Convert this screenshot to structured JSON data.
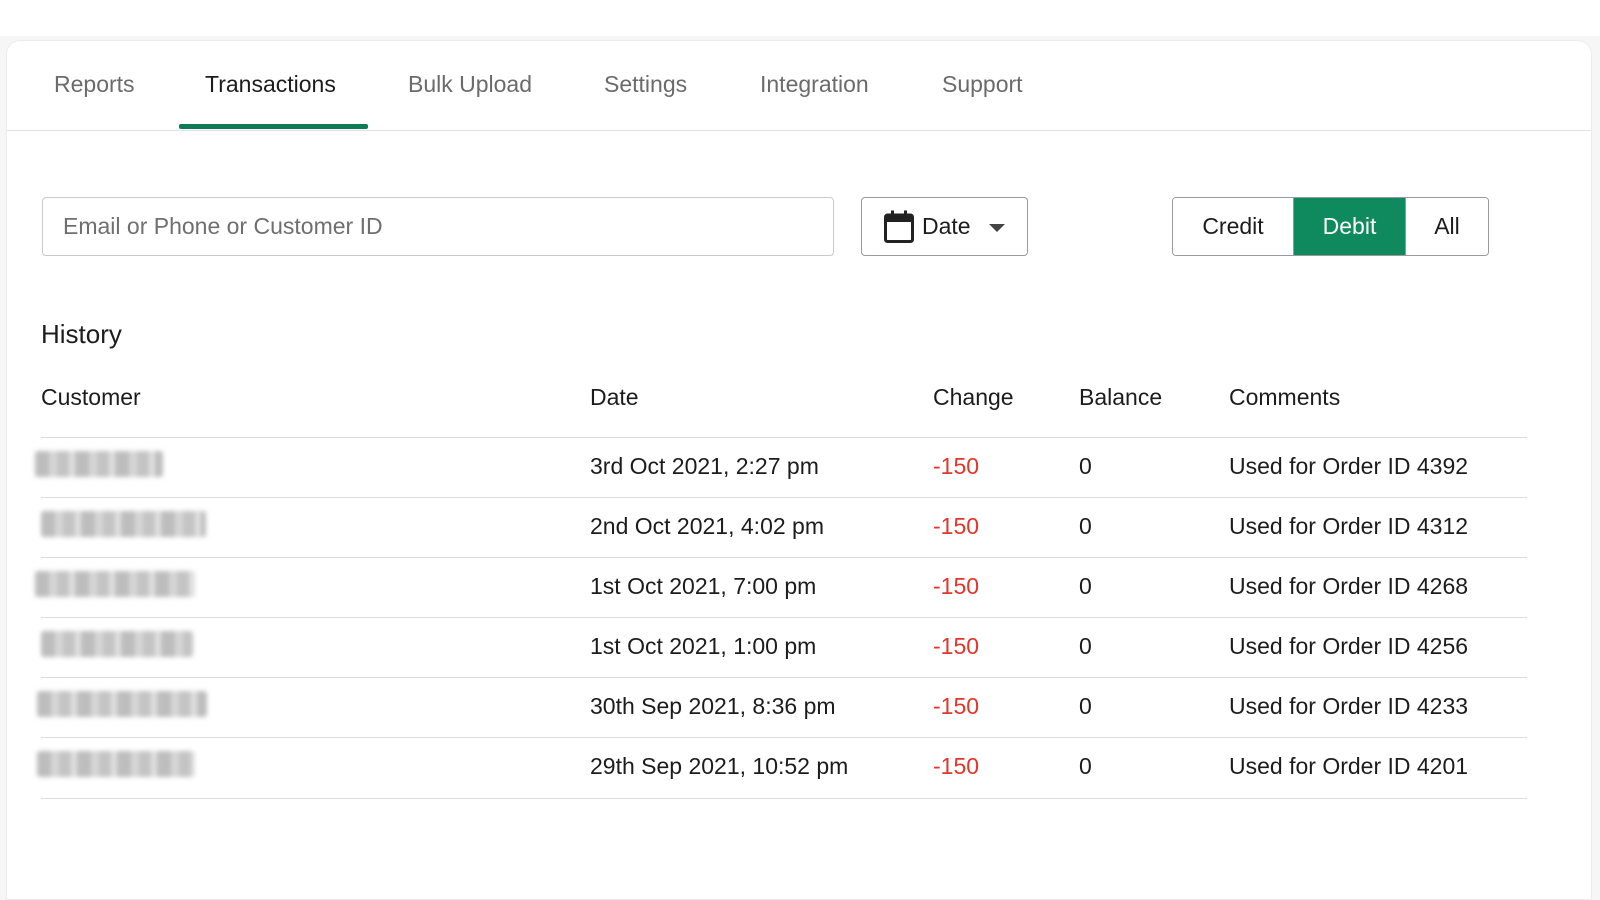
{
  "tabs": [
    {
      "label": "Reports"
    },
    {
      "label": "Transactions"
    },
    {
      "label": "Bulk Upload"
    },
    {
      "label": "Settings"
    },
    {
      "label": "Integration"
    },
    {
      "label": "Support"
    }
  ],
  "active_tab": "Transactions",
  "search": {
    "placeholder": "Email or Phone or Customer ID",
    "value": ""
  },
  "date_filter": {
    "label": "Date"
  },
  "type_filter": {
    "options": [
      "Credit",
      "Debit",
      "All"
    ],
    "selected": "Debit"
  },
  "history": {
    "title": "History",
    "columns": [
      "Customer",
      "Date",
      "Change",
      "Balance",
      "Comments"
    ],
    "rows": [
      {
        "date": "3rd Oct 2021, 2:27 pm",
        "change": "-150",
        "balance": "0",
        "comment": "Used for Order ID 4392"
      },
      {
        "date": "2nd Oct 2021, 4:02 pm",
        "change": "-150",
        "balance": "0",
        "comment": "Used for Order ID 4312"
      },
      {
        "date": "1st Oct 2021, 7:00 pm",
        "change": "-150",
        "balance": "0",
        "comment": "Used for Order ID 4268"
      },
      {
        "date": "1st Oct 2021, 1:00 pm",
        "change": "-150",
        "balance": "0",
        "comment": "Used for Order ID 4256"
      },
      {
        "date": "30th Sep 2021, 8:36 pm",
        "change": "-150",
        "balance": "0",
        "comment": "Used for Order ID 4233"
      },
      {
        "date": "29th Sep 2021, 10:52 pm",
        "change": "-150",
        "balance": "0",
        "comment": "Used for Order ID 4201"
      }
    ]
  },
  "colors": {
    "accent": "#0f8a5f",
    "negative": "#e2362b"
  }
}
